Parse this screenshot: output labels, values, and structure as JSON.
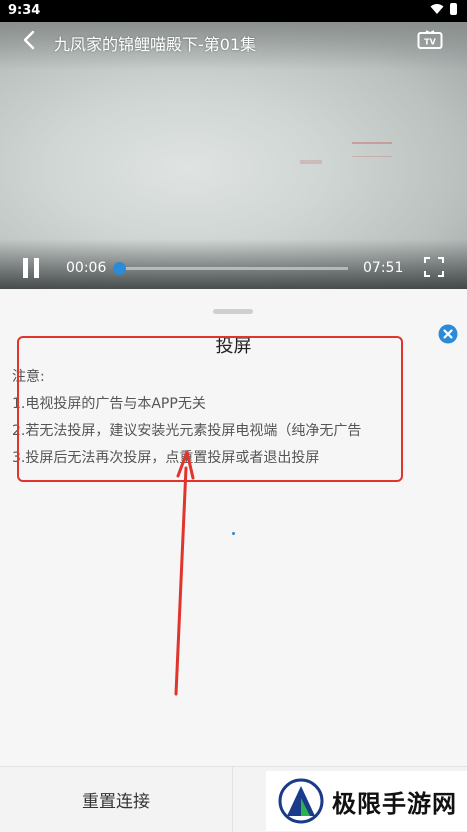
{
  "status_bar": {
    "time": "9:34"
  },
  "player": {
    "title": "九凤家的锦鲤喵殿下-第01集",
    "current_time": "00:06",
    "total_time": "07:51",
    "progress_fraction": 0.013
  },
  "cast_sheet": {
    "title": "投屏",
    "notice_label": "注意:",
    "notices": [
      "1.电视投屏的广告与本APP无关",
      "2.若无法投屏，建议安装光元素投屏电视端（纯净无广告",
      "3.投屏后无法再次投屏，点重置投屏或者退出投屏"
    ]
  },
  "bottom_bar": {
    "reset_label": "重置连接"
  },
  "watermark": {
    "text": "极限手游网"
  },
  "colors": {
    "accent": "#2b8bd9",
    "annotation": "#e0342c"
  }
}
